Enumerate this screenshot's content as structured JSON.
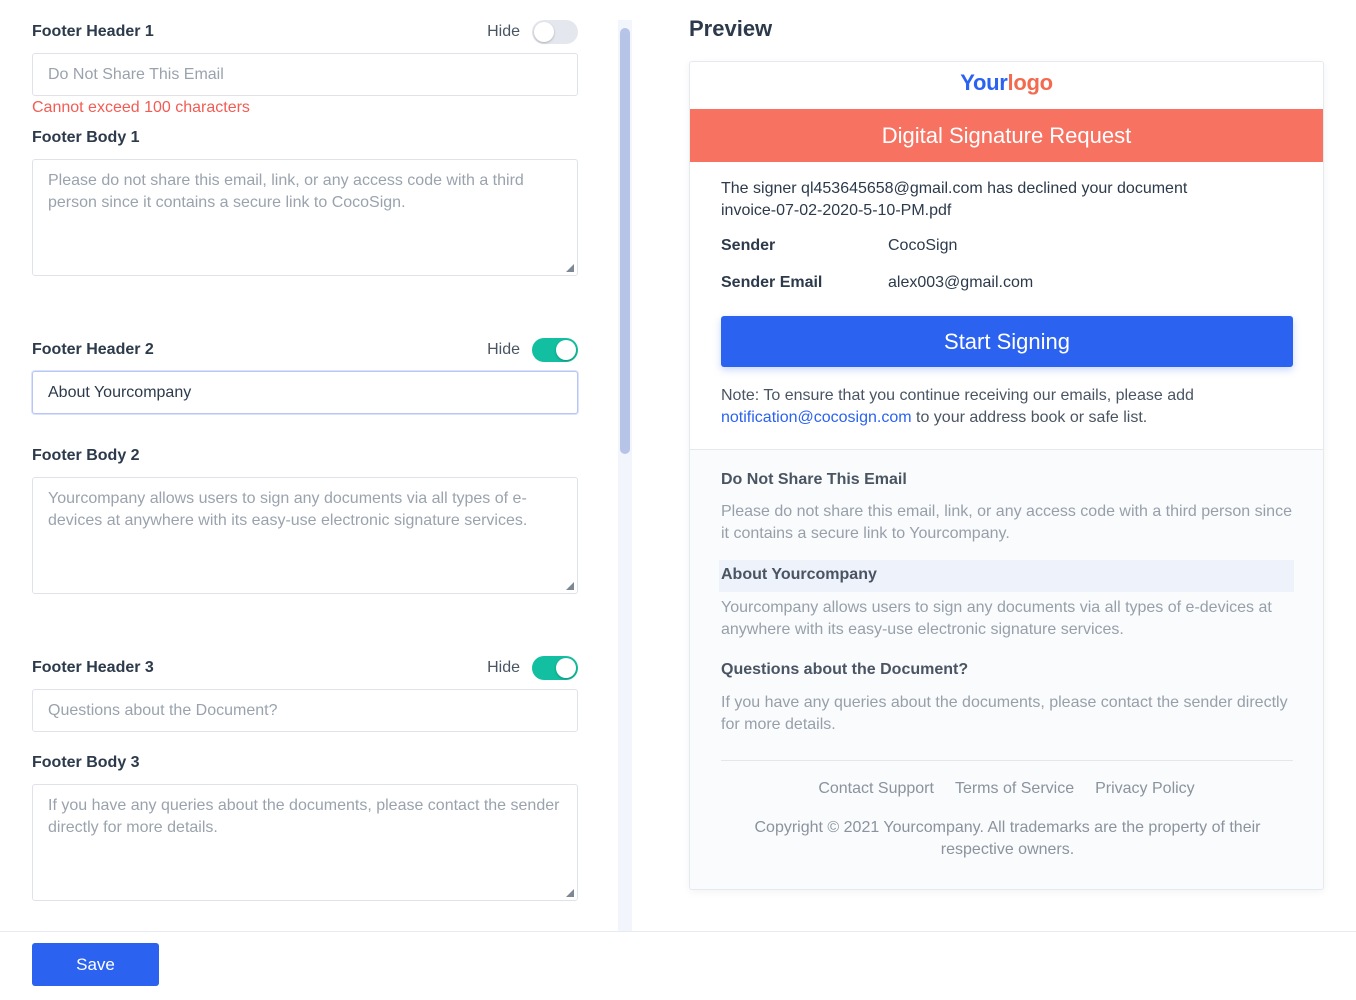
{
  "form": {
    "footer1": {
      "header_label": "Footer Header 1",
      "hide_label": "Hide",
      "hide_on": false,
      "header_placeholder": "Do Not Share This Email",
      "error": "Cannot exceed 100 characters",
      "body_label": "Footer Body 1",
      "body_placeholder": "Please do not share this email, link, or any access code with a third person since it contains a secure link to CocoSign."
    },
    "footer2": {
      "header_label": "Footer Header 2",
      "hide_label": "Hide",
      "hide_on": true,
      "header_value": "About Yourcompany",
      "body_label": "Footer Body 2",
      "body_placeholder": "Yourcompany allows users to sign any documents via all types of e-devices at anywhere with its easy-use electronic signature services."
    },
    "footer3": {
      "header_label": "Footer Header 3",
      "hide_label": "Hide",
      "hide_on": true,
      "header_placeholder": "Questions about the Document?",
      "body_label": "Footer Body 3",
      "body_placeholder": "If you have any queries about the documents, please contact the sender directly for more details."
    },
    "save_label": "Save"
  },
  "preview": {
    "title": "Preview",
    "logo_part1": "Your",
    "logo_part2": "logo",
    "banner": "Digital Signature Request",
    "message_line1": "The signer ql453645658@gmail.com has declined your document",
    "message_line2": "invoice-07-02-2020-5-10-PM.pdf",
    "sender_label": "Sender",
    "sender_value": "CocoSign",
    "sender_email_label": "Sender Email",
    "sender_email_value": "alex003@gmail.com",
    "start_signing": "Start Signing",
    "note_prefix": "Note: To ensure that you continue receiving our emails, please add",
    "note_email": "notification@cocosign.com",
    "note_suffix": " to your address book or safe list.",
    "footer1_header": "Do Not Share This Email",
    "footer1_body": "Please do not share this email, link, or any access code with a third person since it contains a secure link to Yourcompany.",
    "footer2_header": "About Yourcompany",
    "footer2_body": "Yourcompany allows users to sign any documents via all types of e-devices at anywhere with its easy-use electronic signature services.",
    "footer3_header": "Questions about the Document?",
    "footer3_body": "If you have any queries about the documents, please contact the sender directly for more details.",
    "links": [
      "Contact Support",
      "Terms of Service",
      "Privacy Policy"
    ],
    "copyright": "Copyright © 2021 Yourcompany. All trademarks are the property of their respective owners."
  },
  "colors": {
    "primary": "#2b62f0",
    "banner": "#f87262",
    "toggle_on": "#12bfa0",
    "error": "#f25c54"
  }
}
